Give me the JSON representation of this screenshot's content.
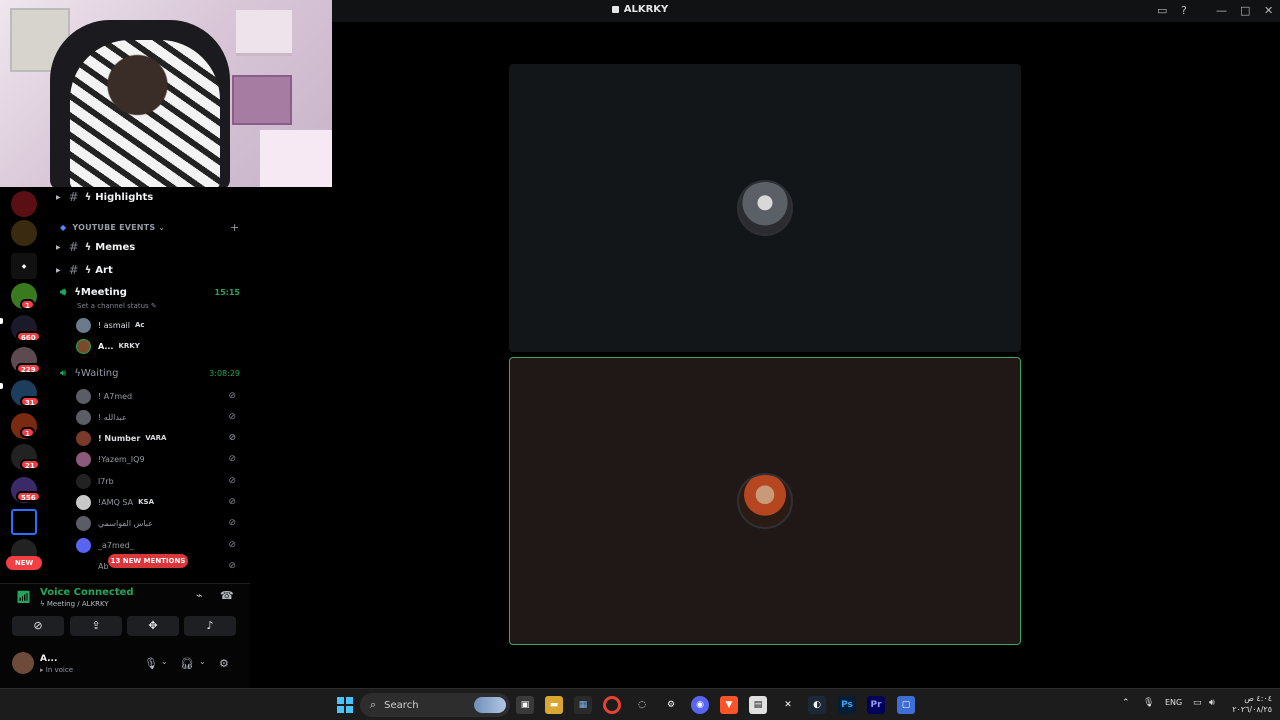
{
  "window": {
    "title": "ALKRKY"
  },
  "sidebar": {
    "channels": [
      {
        "name": "Highlights"
      },
      {
        "name": "Memes"
      },
      {
        "name": "Art"
      }
    ],
    "category": "YOUTUBE EVENTS",
    "category_add": "+",
    "meeting": {
      "name": "Meeting",
      "time": "15:15",
      "status": "Set a channel status"
    },
    "meeting_users": [
      {
        "name": "! asmail",
        "tag": "Ac"
      },
      {
        "name": "A...",
        "tag": "KRKY"
      }
    ],
    "waiting": {
      "name": "Waiting",
      "time": "3:08:29"
    },
    "waiting_users": [
      {
        "name": "! A7med",
        "tag": ""
      },
      {
        "name": "! عبدالله",
        "tag": ""
      },
      {
        "name": "! Number",
        "tag": "VARA"
      },
      {
        "name": "!Yazem_IQ9",
        "tag": ""
      },
      {
        "name": "l7rb",
        "tag": ""
      },
      {
        "name": "!AMQ SA",
        "tag": "KSA"
      },
      {
        "name": "عباس الفواسمي",
        "tag": ""
      },
      {
        "name": "_a7med_",
        "tag": ""
      },
      {
        "name": "Ab",
        "tag": ""
      }
    ],
    "mentions": "13 NEW MENTIONS"
  },
  "rail": {
    "badges": [
      "1",
      "660",
      "229",
      "31",
      "1",
      "21",
      "556"
    ],
    "new_label": "NEW"
  },
  "voice": {
    "connected": "Voice Connected",
    "location": "Meeting / ALKRKY",
    "user_name": "A...",
    "user_status": "In voice"
  },
  "taskbar": {
    "search": "Search",
    "lang": "ENG",
    "time": "٤:٠٤ ص",
    "date": "٢٠٢٦/٠٨/٢٥"
  },
  "colors": {
    "accent_green": "#23a55a",
    "badge_red": "#f23f43",
    "speaking_border": "#3ba55d"
  }
}
